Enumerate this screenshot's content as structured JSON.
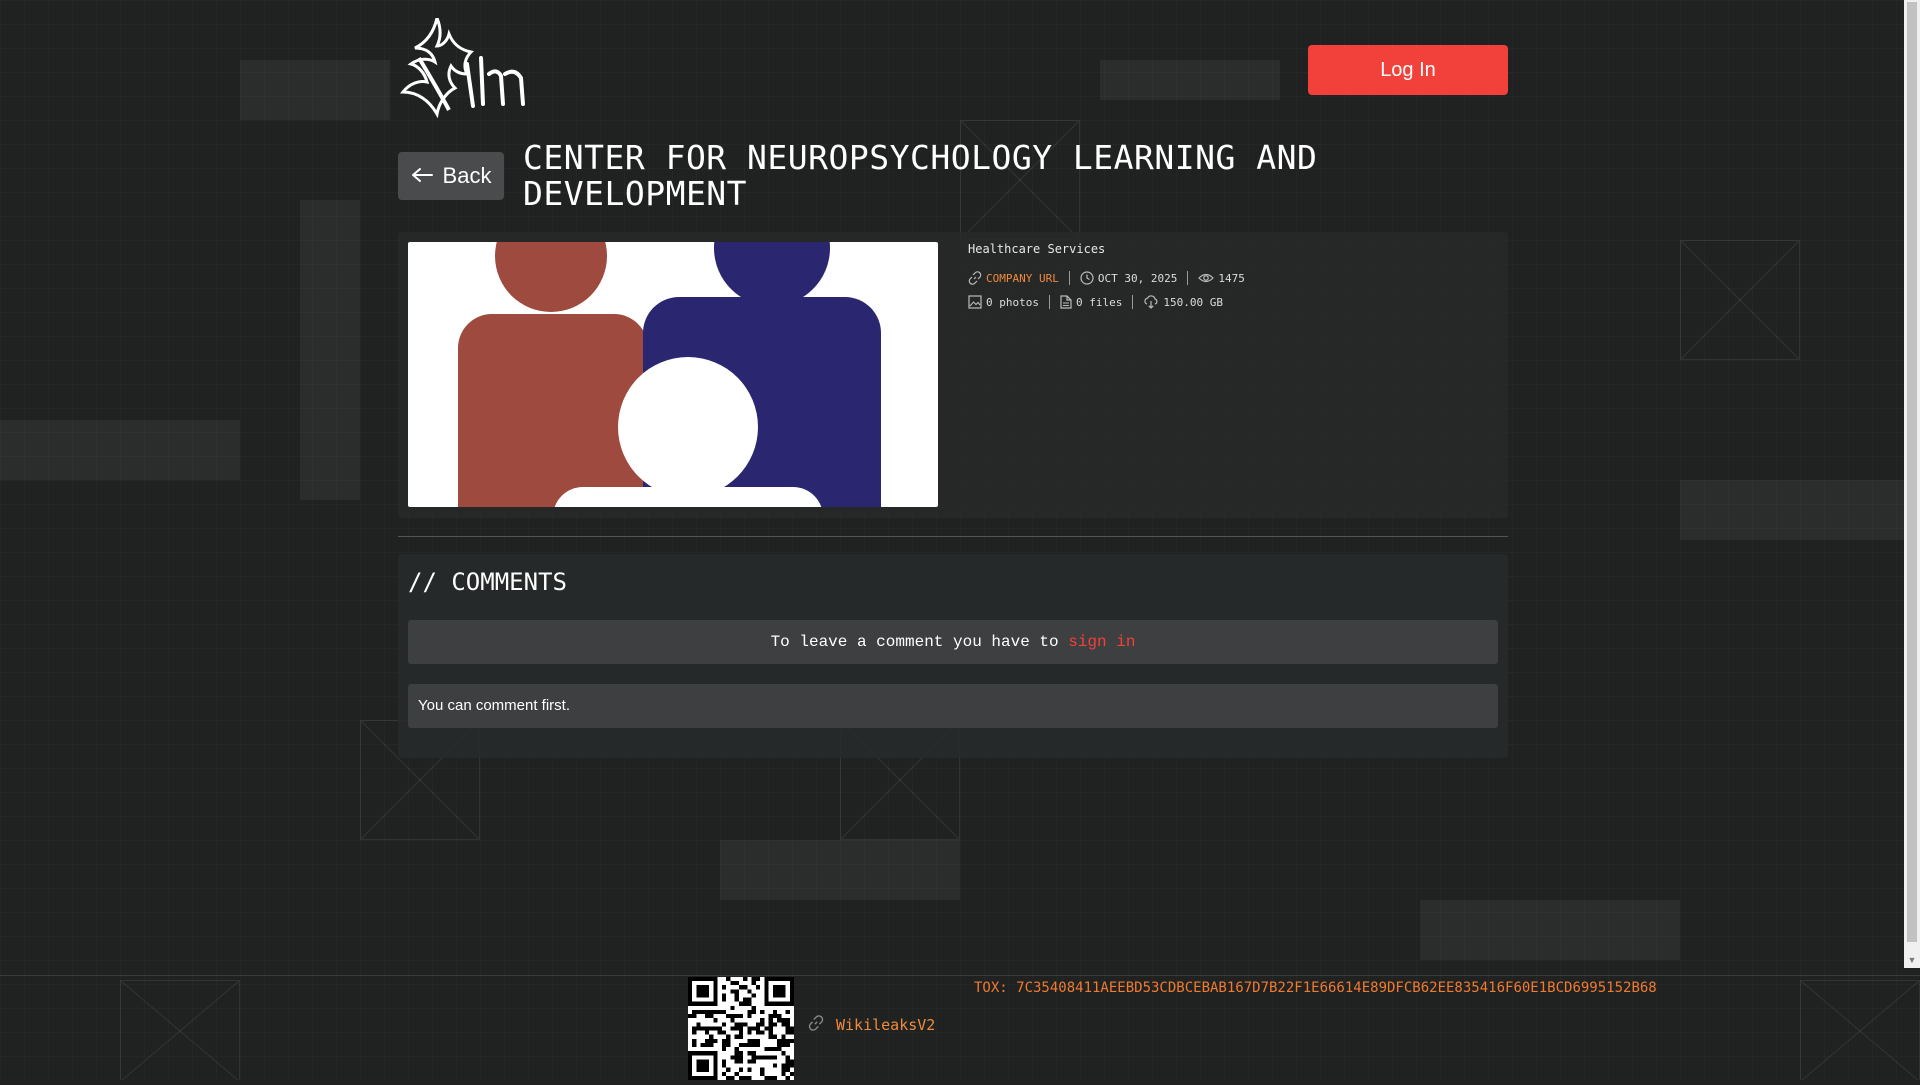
{
  "header": {
    "logo_icon": "qilin-horned-logo",
    "login_label": "Log In"
  },
  "post": {
    "back_label": "Back",
    "title": "CENTER FOR NEUROPSYCHOLOGY LEARNING AND DEVELOPMENT",
    "industry": "Healthcare Services",
    "company_url_label": "COMPANY URL",
    "date": "OCT 30, 2025",
    "views": "1475",
    "photos": "0 photos",
    "files": "0 files",
    "size": "150.00 GB",
    "image_colors": [
      "#9e4a3e",
      "#2b2670",
      "#ffffff"
    ]
  },
  "comments": {
    "heading": "// COMMENTS",
    "notice_prefix": "To leave a comment you have to",
    "notice_link": "sign in",
    "empty_message": "You can comment first."
  },
  "footer": {
    "tox": "TOX: 7C35408411AEEBD53CDBCEBAB167D7B22F1E66614E89DFCB62EE835416F60E1BCD6995152B68",
    "wiki_label": "WikileaksV2",
    "qr_icon": "qr-code"
  },
  "colors": {
    "accent": "#f2403a",
    "link": "#f08a3c",
    "background": "#202221"
  }
}
